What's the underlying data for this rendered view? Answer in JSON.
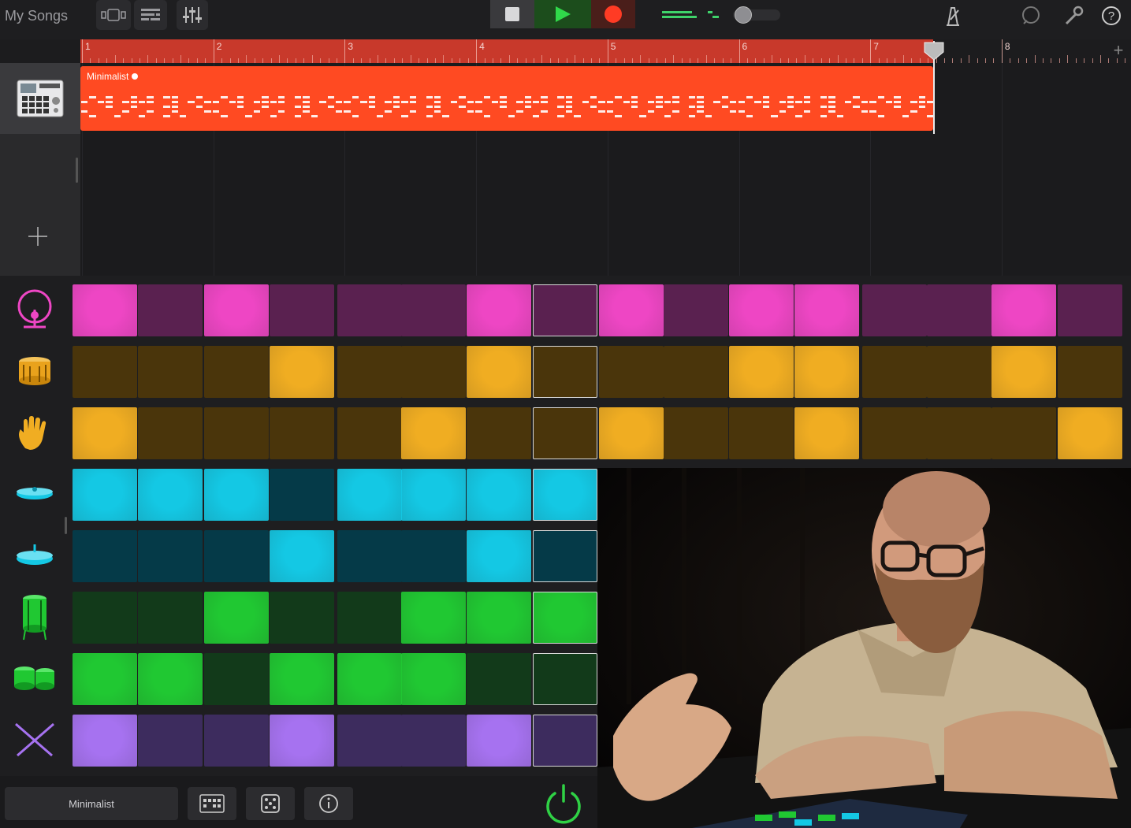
{
  "toolbar": {
    "my_songs_label": "My Songs",
    "transport": {
      "stop": "stop",
      "play": "play",
      "record": "record"
    },
    "icons": [
      "view-toggle-icon",
      "tracks-view-icon",
      "mixer-icon",
      "metronome-icon",
      "loop-browser-icon",
      "settings-wrench-icon",
      "help-icon"
    ]
  },
  "ruler": {
    "bars": [
      "1",
      "2",
      "3",
      "4",
      "5",
      "6",
      "7",
      "8"
    ]
  },
  "region": {
    "name": "Minimalist"
  },
  "bottom": {
    "pattern_name": "Minimalist"
  },
  "colors": {
    "magenta_on": "#ee46c4",
    "magenta_off": "#5a2150",
    "amber_on": "#f0ad22",
    "amber_off": "#4a350b",
    "cyan_on": "#14c8e4",
    "cyan_off": "#053a48",
    "green_on": "#20c832",
    "green_off": "#123a1a",
    "violet_on": "#a672f0",
    "violet_off": "#3d2c5e",
    "region": "#ff4a22",
    "ruler": "#c8392b"
  },
  "sequencer": {
    "current_step": 8,
    "rows": [
      {
        "instrument": "kick-drum-icon",
        "color": "magenta",
        "steps": [
          1,
          0,
          1,
          0,
          0,
          0,
          1,
          0,
          1,
          0,
          1,
          1,
          0,
          0,
          1,
          0
        ]
      },
      {
        "instrument": "snare-drum-icon",
        "color": "amber",
        "steps": [
          0,
          0,
          0,
          1,
          0,
          0,
          1,
          0,
          0,
          0,
          1,
          1,
          0,
          0,
          1,
          0
        ]
      },
      {
        "instrument": "clap-hand-icon",
        "color": "amber",
        "steps": [
          1,
          0,
          0,
          0,
          0,
          1,
          0,
          0,
          1,
          0,
          0,
          1,
          0,
          0,
          0,
          1
        ]
      },
      {
        "instrument": "closed-hihat-icon",
        "color": "cyan",
        "steps": [
          1,
          1,
          1,
          0,
          1,
          1,
          1,
          1
        ]
      },
      {
        "instrument": "open-hihat-icon",
        "color": "cyan",
        "steps": [
          0,
          0,
          0,
          1,
          0,
          0,
          1,
          0
        ]
      },
      {
        "instrument": "tom-drum-icon",
        "color": "green",
        "steps": [
          0,
          0,
          1,
          0,
          0,
          1,
          1,
          1
        ]
      },
      {
        "instrument": "bongos-icon",
        "color": "green",
        "steps": [
          1,
          1,
          0,
          1,
          1,
          1,
          0,
          0
        ]
      },
      {
        "instrument": "drumsticks-icon",
        "color": "violet",
        "steps": [
          1,
          0,
          0,
          1,
          0,
          0,
          1,
          0
        ]
      }
    ]
  }
}
